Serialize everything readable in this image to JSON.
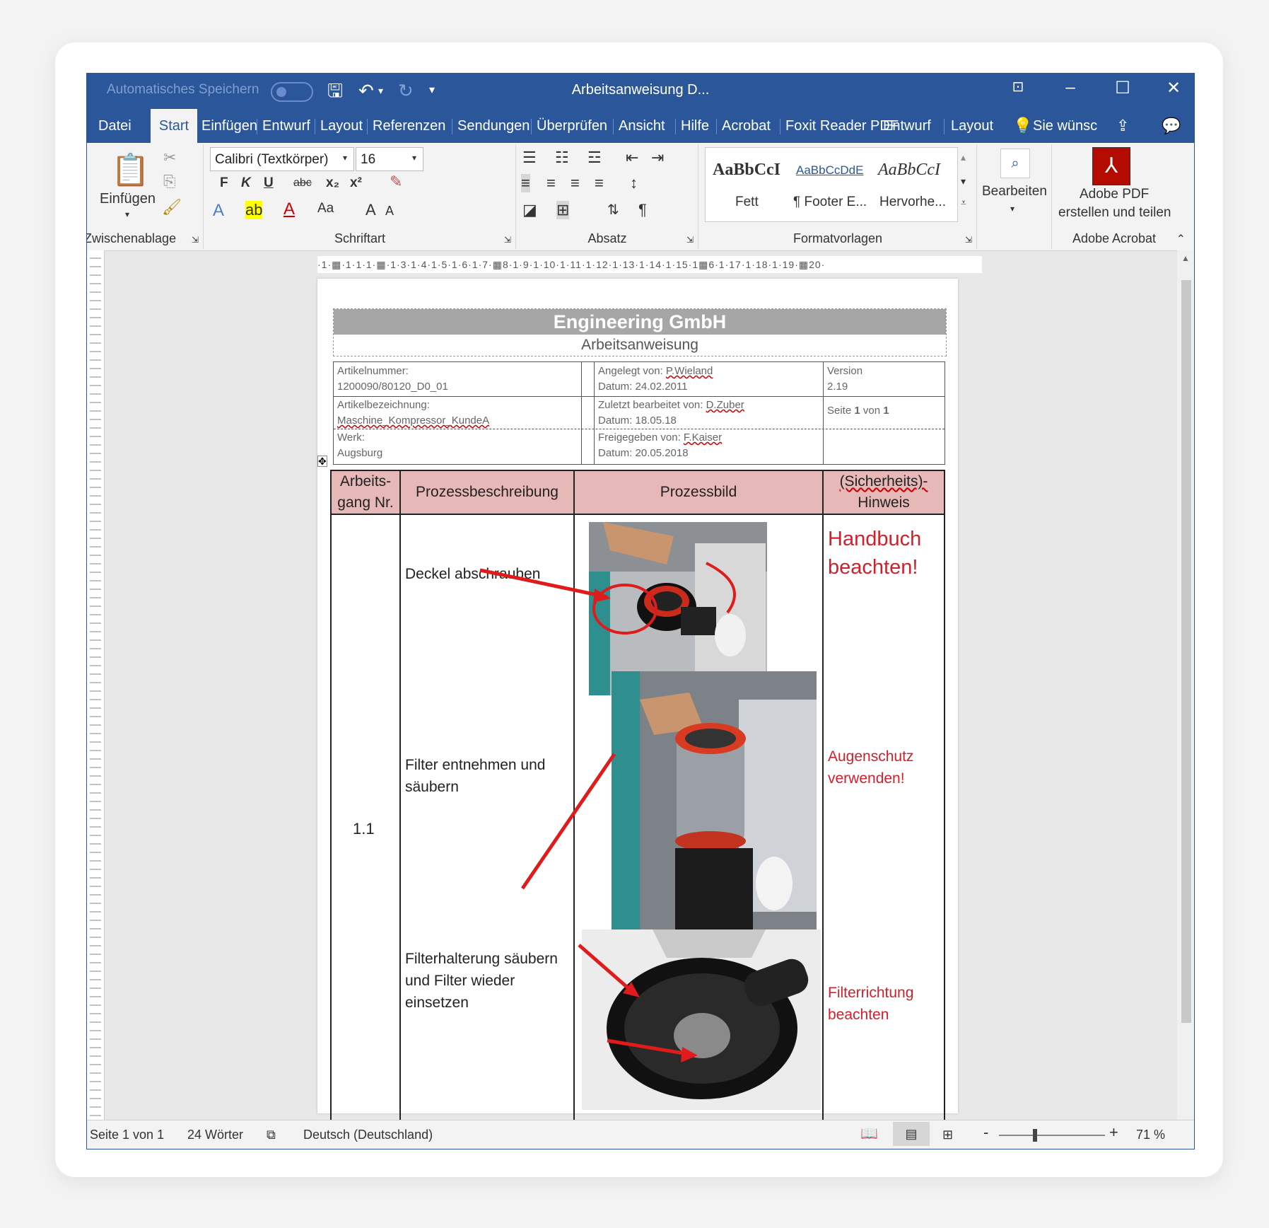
{
  "titlebar": {
    "autosave_label": "Automatisches Speichern",
    "doc_title": "Arbeitsanweisung D..."
  },
  "tabs": [
    "Datei",
    "Start",
    "Einfügen",
    "Entwurf",
    "Layout",
    "Referenzen",
    "Sendungen",
    "Überprüfen",
    "Ansicht",
    "Hilfe",
    "Acrobat",
    "Foxit Reader PDF",
    "Entwurf",
    "Layout",
    "Sie wünsc"
  ],
  "ribbon": {
    "clipboard": {
      "paste_label": "Einfügen",
      "group_label": "Zwischenablage"
    },
    "font": {
      "font_name": "Calibri (Textkörper)",
      "font_size": "16",
      "bold": "F",
      "italic": "K",
      "underline": "U",
      "strike": "abc",
      "sub": "x₂",
      "sup": "x²",
      "case": "Aa",
      "grow": "A",
      "shrink": "A",
      "group_label": "Schriftart"
    },
    "paragraph": {
      "group_label": "Absatz",
      "pilcrow": "¶"
    },
    "styles": {
      "items": [
        {
          "preview": "AaBbCcI",
          "name": "Fett"
        },
        {
          "preview": "AaBbCcDdE",
          "name": "¶ Footer E..."
        },
        {
          "preview": "AaBbCcI",
          "name": "Hervorhe..."
        }
      ],
      "group_label": "Formatvorlagen"
    },
    "editing": {
      "label": "Bearbeiten"
    },
    "acrobat": {
      "label_line1": "Adobe PDF",
      "label_line2": "erstellen und teilen",
      "group_label": "Adobe Acrobat"
    }
  },
  "ruler": {
    "text": "·1·▦·1·1·1·▦·1·3·1·4·1·5·1·6·1·7·▦8·1·9·1·10·1·11·1·12·1·13·1·14·1·15·1▦6·1·17·1·18·1·19·▦20·"
  },
  "document": {
    "company": "Engineering GmbH",
    "subtitle": "Arbeitsanweisung",
    "meta": {
      "artikelnummer_label": "Artikelnummer:",
      "artikelnummer": "1200090/80120_D0_01",
      "angelegt_label": "Angelegt von:",
      "angelegt": "P.Wieland",
      "datum1": "Datum: 24.02.2011",
      "version_label": "Version",
      "version": "2.19",
      "bez_label": "Artikelbezeichnung:",
      "bez": "Maschine_Kompressor_KundeA",
      "zuletzt_label": "Zuletzt bearbeitet von:",
      "zuletzt": "D.Zuber",
      "datum2": "Datum: 18.05.18",
      "seite_pre": "Seite ",
      "seite_num": "1",
      "seite_mid": " von ",
      "seite_total": "1",
      "werk_label": "Werk:",
      "werk": "Augsburg",
      "frei_label": "Freigegeben von:",
      "frei": "F.Kaiser",
      "datum3": "Datum: 20.05.2018"
    },
    "table": {
      "headers": {
        "col1a": "Arbeits-",
        "col1b": "gang Nr.",
        "col2": "Prozessbeschreibung",
        "col3": "Prozessbild",
        "col4a": "(Sicherheits)-",
        "col4b": "Hinweis"
      },
      "step_nr": "1.1",
      "rows": [
        {
          "desc1": "Deckel abschrauben",
          "desc2": "",
          "desc3": "",
          "hint1": "Handbuch",
          "hint2": "beachten!"
        },
        {
          "desc1": "Filter entnehmen und",
          "desc2": "säubern",
          "desc3": "",
          "hint1": "Augenschutz",
          "hint2": "verwenden!"
        },
        {
          "desc1": "Filterhalterung säubern",
          "desc2": "und Filter wieder",
          "desc3": "einsetzen",
          "hint1": "Filterrichtung",
          "hint2": "beachten"
        }
      ]
    }
  },
  "status": {
    "page": "Seite 1 von 1",
    "words": "24 Wörter",
    "language": "Deutsch (Deutschland)",
    "zoom": "71 %",
    "zoom_minus": "-",
    "zoom_plus": "+"
  },
  "colors": {
    "accent": "#2b579a",
    "header_fill": "#e6b8b7",
    "hint_red": "#d0202c",
    "company_bar": "#a6a6a6"
  }
}
